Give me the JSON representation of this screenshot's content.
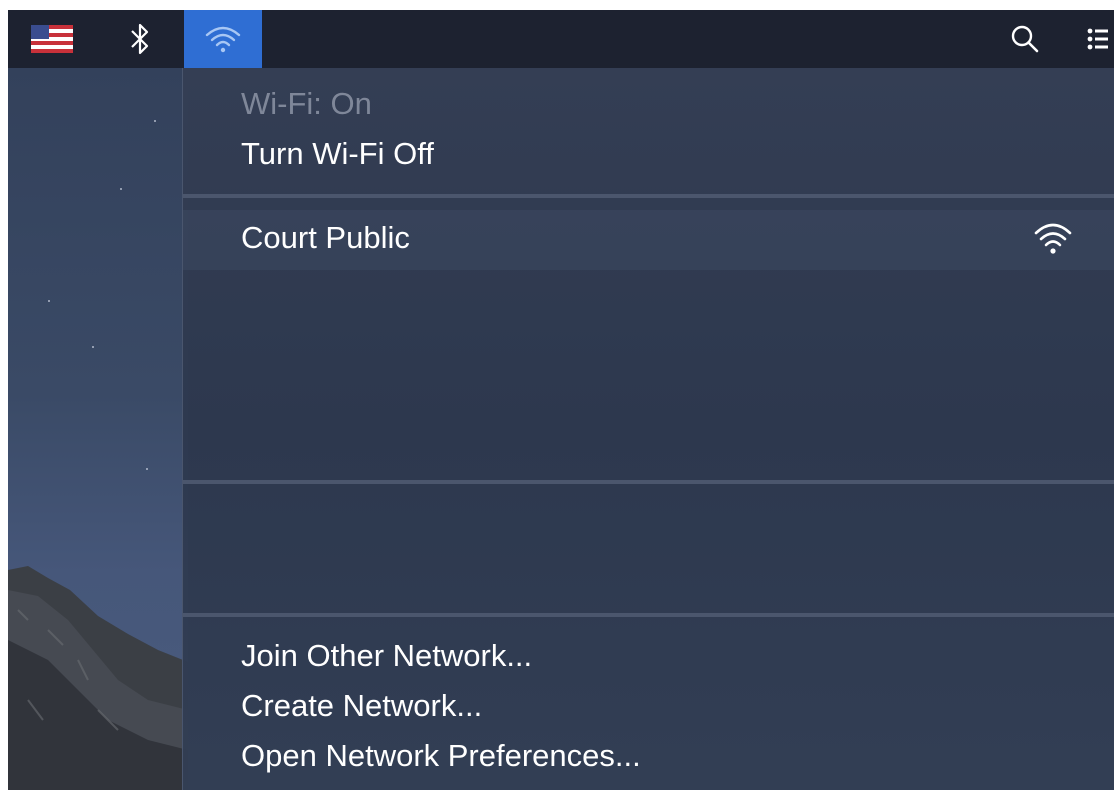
{
  "menubar": {
    "icons": {
      "flag": "us-flag-icon",
      "bluetooth": "bluetooth-icon",
      "wifi": "wifi-icon",
      "search": "search-icon",
      "list": "list-icon"
    },
    "wifi_highlight_color": "#2f6ed3"
  },
  "wifi_menu": {
    "status": "Wi-Fi: On",
    "toggle": "Turn Wi-Fi Off",
    "networks": [
      {
        "name": "Court Public",
        "signal_icon": "wifi-signal-icon"
      }
    ],
    "actions": {
      "join_other": "Join Other Network...",
      "create": "Create Network...",
      "preferences": "Open Network Preferences..."
    }
  }
}
